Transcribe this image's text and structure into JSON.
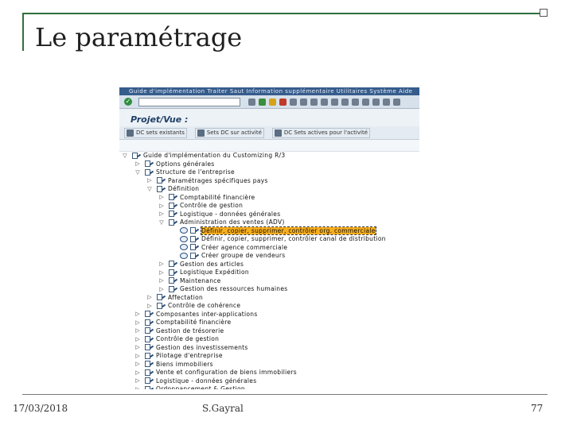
{
  "slide": {
    "title": "Le paramétrage",
    "footer_date": "17/03/2018",
    "footer_author": "S.Gayral",
    "footer_page": "77"
  },
  "sap": {
    "menu": "Guide d'implémentation   Traiter   Saut   Information supplémentaire   Utilitaires   Système   Aide",
    "screen_title": "Projet/Vue :",
    "app_buttons": [
      "DC sets existants",
      "Sets DC sur activité",
      "DC Sets actives pour l'activité"
    ],
    "tree": [
      {
        "level": 0,
        "exp": "▽",
        "type": "doc",
        "label": "Guide d'implémentation du Customizing R/3"
      },
      {
        "level": 1,
        "exp": "▷",
        "type": "doc",
        "label": "Options générales"
      },
      {
        "level": 1,
        "exp": "▽",
        "type": "doc",
        "label": "Structure de l'entreprise"
      },
      {
        "level": 2,
        "exp": "▷",
        "type": "doc",
        "label": "Paramétrages spécifiques pays"
      },
      {
        "level": 2,
        "exp": "▽",
        "type": "doc",
        "label": "Définition"
      },
      {
        "level": 3,
        "exp": "▷",
        "type": "doc",
        "label": "Comptabilité financière"
      },
      {
        "level": 3,
        "exp": "▷",
        "type": "doc",
        "label": "Contrôle de gestion"
      },
      {
        "level": 3,
        "exp": "▷",
        "type": "doc",
        "label": "Logistique - données générales"
      },
      {
        "level": 3,
        "exp": "▽",
        "type": "doc",
        "label": "Administration des ventes (ADV)"
      },
      {
        "level": 4,
        "exp": "",
        "type": "exec",
        "label": "Définir, copier, supprimer, contrôler org. commerciale",
        "highlight": true
      },
      {
        "level": 4,
        "exp": "",
        "type": "exec",
        "label": "Définir, copier, supprimer, contrôler canal de distribution"
      },
      {
        "level": 4,
        "exp": "",
        "type": "exec",
        "label": "Créer agence commerciale"
      },
      {
        "level": 4,
        "exp": "",
        "type": "exec",
        "label": "Créer groupe de vendeurs"
      },
      {
        "level": 3,
        "exp": "▷",
        "type": "doc",
        "label": "Gestion des articles"
      },
      {
        "level": 3,
        "exp": "▷",
        "type": "doc",
        "label": "Logistique Expédition"
      },
      {
        "level": 3,
        "exp": "▷",
        "type": "doc",
        "label": "Maintenance"
      },
      {
        "level": 3,
        "exp": "▷",
        "type": "doc",
        "label": "Gestion des ressources humaines"
      },
      {
        "level": 2,
        "exp": "▷",
        "type": "doc",
        "label": "Affectation"
      },
      {
        "level": 2,
        "exp": "▷",
        "type": "doc",
        "label": "Contrôle de cohérence"
      },
      {
        "level": 1,
        "exp": "▷",
        "type": "doc",
        "label": "Composantes inter-applications"
      },
      {
        "level": 1,
        "exp": "▷",
        "type": "doc",
        "label": "Comptabilité financière"
      },
      {
        "level": 1,
        "exp": "▷",
        "type": "doc",
        "label": "Gestion de trésorerie"
      },
      {
        "level": 1,
        "exp": "▷",
        "type": "doc",
        "label": "Contrôle de gestion"
      },
      {
        "level": 1,
        "exp": "▷",
        "type": "doc",
        "label": "Gestion des investissements"
      },
      {
        "level": 1,
        "exp": "▷",
        "type": "doc",
        "label": "Pilotage d'entreprise"
      },
      {
        "level": 1,
        "exp": "▷",
        "type": "doc",
        "label": "Biens immobiliers"
      },
      {
        "level": 1,
        "exp": "▷",
        "type": "doc",
        "label": "Vente et configuration de biens immobiliers"
      },
      {
        "level": 1,
        "exp": "▷",
        "type": "doc",
        "label": "Logistique - données générales"
      },
      {
        "level": 1,
        "exp": "▷",
        "type": "doc",
        "label": "Ordonnancement & Gestion"
      }
    ]
  }
}
